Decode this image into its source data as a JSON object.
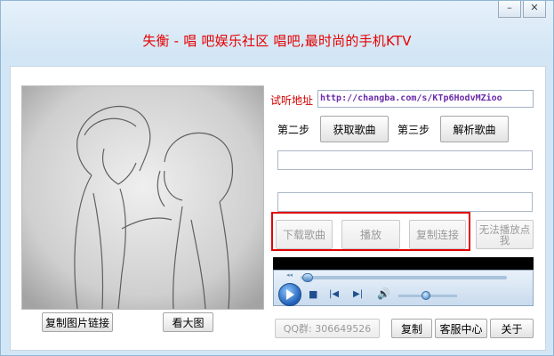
{
  "window": {
    "title": "失衡 - 唱 吧娱乐社区 唱吧,最时尚的手机KTV",
    "minimize_glyph": "–",
    "close_glyph": "✕"
  },
  "left": {
    "copy_image_link": "复制图片链接",
    "view_large": "看大图"
  },
  "listen": {
    "label": "试听地址",
    "url": "http://changba.com/s/KTp6HodvMZioo"
  },
  "steps": {
    "step2_label": "第二步",
    "get_song": "获取歌曲",
    "step3_label": "第三步",
    "parse_song": "解析歌曲"
  },
  "fields": {
    "field1_value": "",
    "field2_value": ""
  },
  "actions": {
    "download": "下载歌曲",
    "play": "播放",
    "copy_link": "复制连接",
    "cannot_play": "无法播放点我"
  },
  "player": {
    "play_icon": "play-icon",
    "stop_glyph": "■",
    "prev_glyph": "|◀",
    "next_glyph": "▶|",
    "volume_glyph": "🔊",
    "seek_left_glyph": "◂◂"
  },
  "footer": {
    "qq_group": "QQ群: 306649526",
    "copy": "复制",
    "service_center": "客服中心",
    "about": "关于"
  },
  "colors": {
    "title_red": "#e60000",
    "highlight_red": "#e00000",
    "url_purple": "#6a2aa8"
  }
}
